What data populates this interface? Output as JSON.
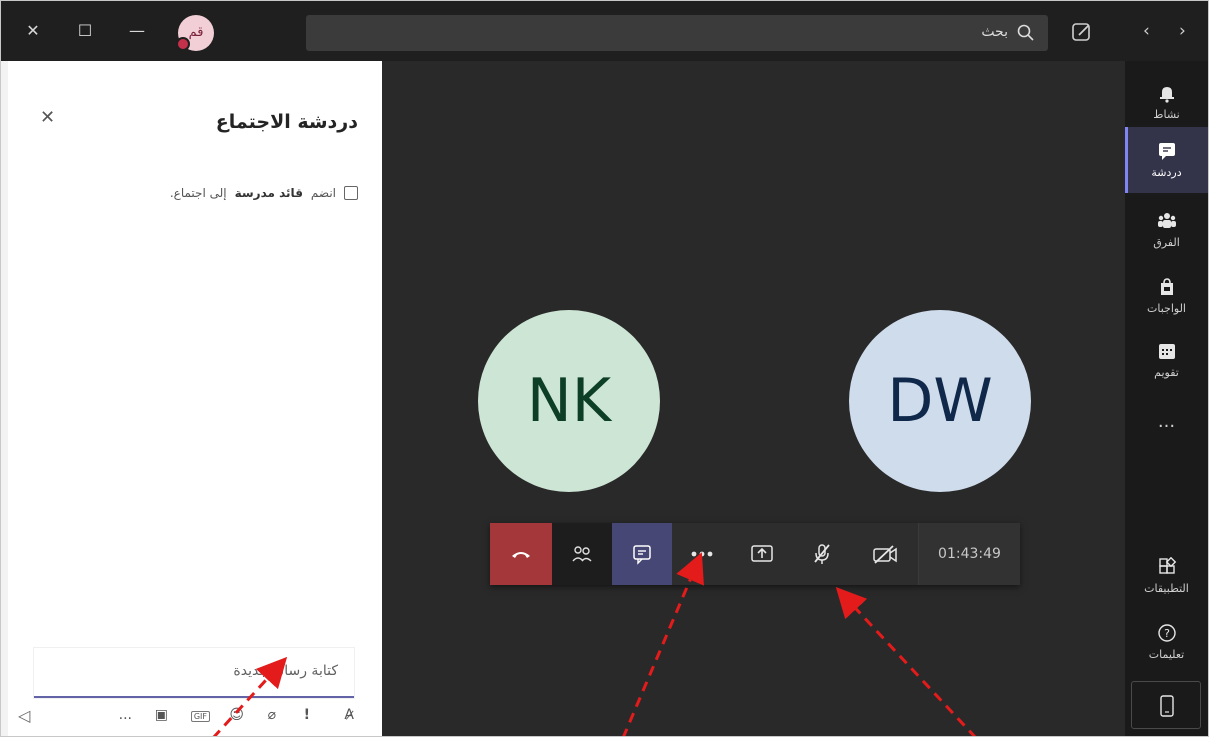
{
  "titlebar": {
    "avatar_initials": "قم",
    "search_placeholder": "بحث",
    "accent": "#c4314b"
  },
  "chat": {
    "title": "دردشة الاجتماع",
    "join_prefix": "انضم",
    "join_name": "قائد مدرسة",
    "join_suffix": "إلى اجتماع.",
    "compose_placeholder": "كتابة رسالة جديدة"
  },
  "stage": {
    "participants": [
      {
        "initials": "NK",
        "bg": "#cde5d5",
        "fg": "#0d3e26"
      },
      {
        "initials": "DW",
        "bg": "#cfdcec",
        "fg": "#10294a"
      }
    ]
  },
  "controls": {
    "timer": "01:43:49",
    "icons": [
      "hang-up-icon",
      "people-icon",
      "chat-icon",
      "more-icon",
      "share-icon",
      "mic-off-icon",
      "camera-off-icon"
    ],
    "hangup_color": "#a4373a",
    "active_color": "#464775"
  },
  "rail": {
    "items": [
      {
        "label": "نشاط",
        "icon": "bell-icon"
      },
      {
        "label": "دردشة",
        "icon": "chat-icon",
        "active": true
      },
      {
        "label": "الفرق",
        "icon": "teams-icon"
      },
      {
        "label": "الواجبات",
        "icon": "assignments-icon"
      },
      {
        "label": "تقويم",
        "icon": "calendar-icon"
      }
    ],
    "more": "...",
    "apps_label": "التطبيقات",
    "help_label": "تعليمات"
  },
  "compose_tools": {
    "more": "...",
    "gif": "GIF",
    "priority": "!"
  }
}
